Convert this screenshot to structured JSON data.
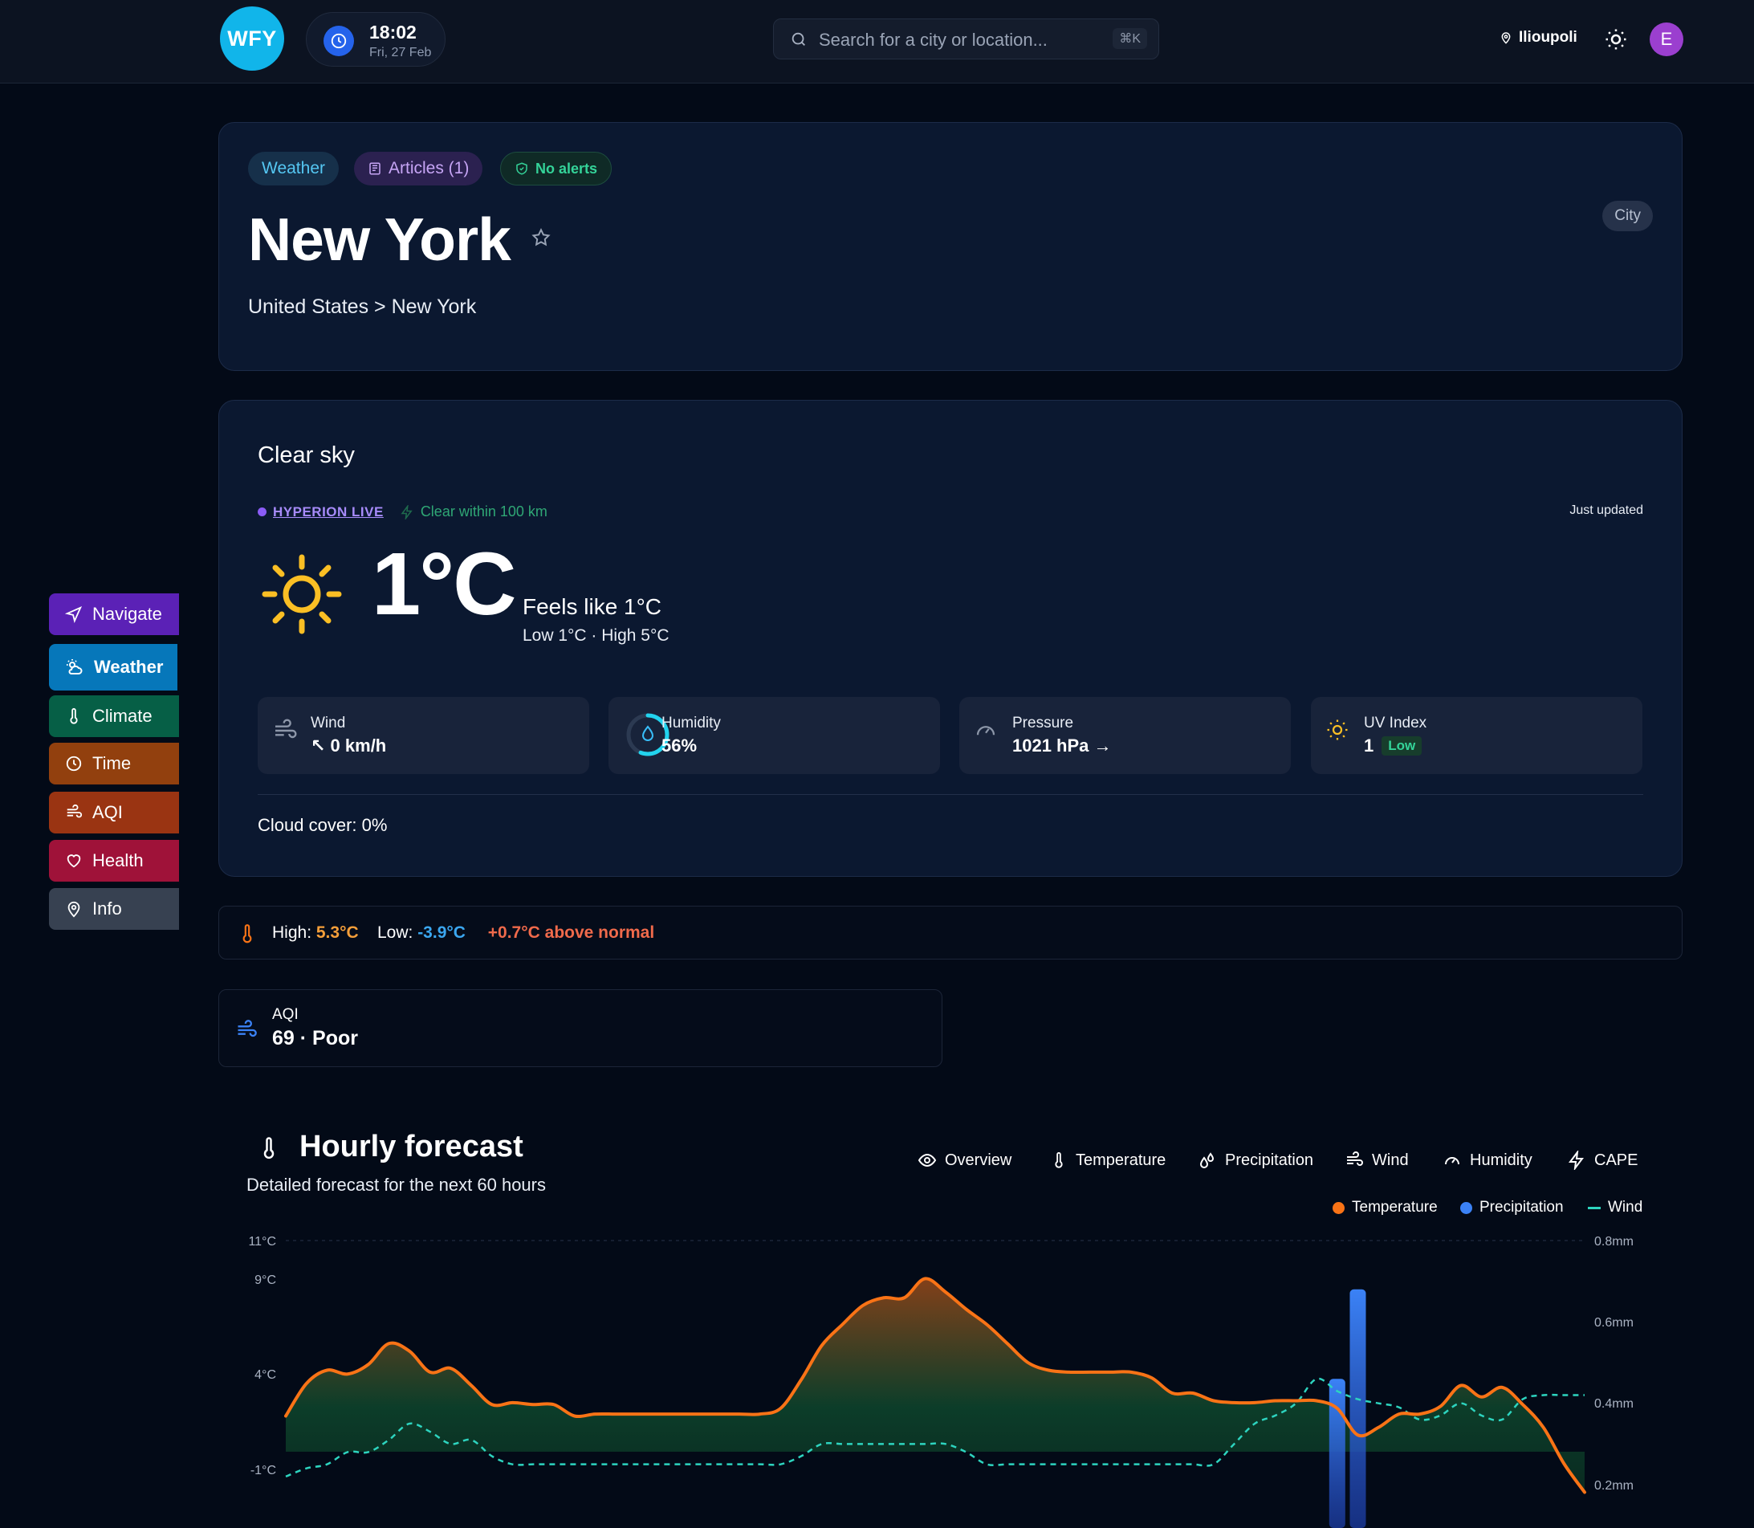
{
  "header": {
    "logo": "WFY",
    "time": "18:02",
    "date": "Fri, 27 Feb",
    "search_placeholder": "Search for a city or location...",
    "search_shortcut": "⌘K",
    "location": "Ilioupoli",
    "avatar_initial": "E"
  },
  "hero": {
    "chips": {
      "weather": "Weather",
      "articles": "Articles (1)",
      "alerts": "No alerts"
    },
    "city": "New York",
    "breadcrumb": "United States > New York",
    "type_badge": "City"
  },
  "current": {
    "condition": "Clear sky",
    "live_label": "HYPERION LIVE",
    "live_status": "Clear within 100 km",
    "updated": "Just updated",
    "temperature": "1°C",
    "feels_like": "Feels like 1°C",
    "low_high": "Low 1°C · High 5°C",
    "metrics": {
      "wind": {
        "label": "Wind",
        "value": "↖ 0 km/h"
      },
      "humidity": {
        "label": "Humidity",
        "value": "56%",
        "percent": 56
      },
      "pressure": {
        "label": "Pressure",
        "value": "1021 hPa →"
      },
      "uv": {
        "label": "UV Index",
        "value": "1",
        "level": "Low"
      }
    },
    "cloud_cover": "Cloud cover: 0%"
  },
  "sidenav": {
    "items": [
      {
        "label": "Navigate",
        "icon": "navigate-icon"
      },
      {
        "label": "Weather",
        "icon": "weather-icon"
      },
      {
        "label": "Climate",
        "icon": "thermometer-icon"
      },
      {
        "label": "Time",
        "icon": "clock-icon"
      },
      {
        "label": "AQI",
        "icon": "wind-icon"
      },
      {
        "label": "Health",
        "icon": "heart-icon"
      },
      {
        "label": "Info",
        "icon": "map-pin-icon"
      }
    ]
  },
  "daily_summary": {
    "high_label": "High:",
    "high_value": "5.3°C",
    "low_label": "Low:",
    "low_value": "-3.9°C",
    "anomaly": "+0.7°C above normal"
  },
  "aqi": {
    "label": "AQI",
    "value": "69 · Poor"
  },
  "forecast": {
    "title": "Hourly forecast",
    "subtitle": "Detailed forecast for the next 60 hours",
    "tabs": [
      "Overview",
      "Temperature",
      "Precipitation",
      "Wind",
      "Humidity",
      "CAPE"
    ],
    "legend": [
      "Temperature",
      "Precipitation",
      "Wind"
    ]
  },
  "colors": {
    "temperature": "#f97316",
    "precipitation": "#3b82f6",
    "wind": "#2dd4bf",
    "accent": "#11b5ea"
  },
  "chart_data": {
    "type": "line",
    "y_left_ticks": [
      "11°C",
      "9°C",
      "4°C",
      "-1°C"
    ],
    "y_right_ticks": [
      "0.8mm",
      "0.6mm",
      "0.4mm",
      "0.2mm"
    ],
    "ylim_left": [
      -1,
      11
    ],
    "ylim_right": [
      0.2,
      0.8
    ],
    "series": [
      {
        "name": "Temperature",
        "values": [
          1.8,
          3.5,
          4.2,
          4.0,
          4.5,
          5.6,
          5.2,
          4.1,
          4.3,
          3.4,
          2.4,
          2.5,
          2.4,
          2.4,
          1.8,
          1.9,
          1.9,
          1.9,
          1.9,
          1.9,
          1.9,
          1.9,
          1.9,
          1.9,
          2.2,
          3.7,
          5.5,
          6.6,
          7.6,
          8.0,
          8.0,
          9.0,
          8.3,
          7.4,
          6.6,
          5.6,
          4.6,
          4.2,
          4.1,
          4.1,
          4.1,
          4.1,
          3.8,
          3.0,
          3.0,
          2.6,
          2.5,
          2.5,
          2.6,
          2.6,
          2.6,
          2.2,
          0.8,
          1.2,
          1.9,
          1.9,
          2.3,
          3.4,
          2.8,
          3.3,
          2.4,
          1.2,
          -0.7,
          -2.2
        ]
      },
      {
        "name": "Wind",
        "values": [
          0.22,
          0.24,
          0.25,
          0.28,
          0.28,
          0.31,
          0.35,
          0.33,
          0.3,
          0.31,
          0.27,
          0.25,
          0.25,
          0.25,
          0.25,
          0.25,
          0.25,
          0.25,
          0.25,
          0.25,
          0.25,
          0.25,
          0.25,
          0.25,
          0.25,
          0.27,
          0.3,
          0.3,
          0.3,
          0.3,
          0.3,
          0.3,
          0.3,
          0.28,
          0.25,
          0.25,
          0.25,
          0.25,
          0.25,
          0.25,
          0.25,
          0.25,
          0.25,
          0.25,
          0.25,
          0.25,
          0.3,
          0.35,
          0.37,
          0.4,
          0.46,
          0.43,
          0.41,
          0.4,
          0.39,
          0.36,
          0.37,
          0.4,
          0.37,
          0.36,
          0.41,
          0.42,
          0.42,
          0.42
        ]
      },
      {
        "name": "Precipitation",
        "bars": [
          {
            "index": 51,
            "value": 0.46
          },
          {
            "index": 52,
            "value": 0.68
          }
        ]
      }
    ]
  }
}
